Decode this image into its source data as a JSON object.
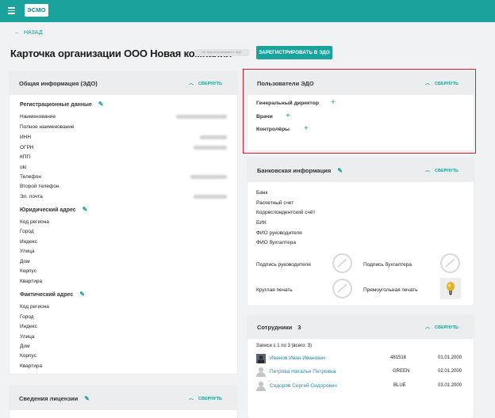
{
  "app": {
    "logo_text": "ЭСМО",
    "brand_color": "#1aa39c"
  },
  "nav": {
    "back_label": "НАЗАД"
  },
  "page": {
    "title": "Карточка организации ООО Новая компания",
    "status_badge": "Не зарегистрирована в ЭДО",
    "register_button": "ЗАРЕГИСТРИРОВАТЬ В ЭДО"
  },
  "general": {
    "title": "Общая информация (ЭДО)",
    "collapse_label": "СВЕРНУТЬ",
    "reg_title": "Регистрационные данные",
    "reg_fields": [
      "Наименование",
      "Полное наименование",
      "ИНН",
      "ОГРН",
      "КПП",
      "oki",
      "Телефон",
      "Второй телефон",
      "Эл. почта"
    ],
    "legal_title": "Юридический адрес",
    "legal_fields": [
      "Код региона",
      "Город",
      "Индекс",
      "Улица",
      "Дом",
      "Корпус",
      "Квартира"
    ],
    "actual_title": "Фактический адрес",
    "actual_fields": [
      "Код региона",
      "Город",
      "Индекс",
      "Улица",
      "Дом",
      "Корпус",
      "Квартира"
    ]
  },
  "license": {
    "title": "Сведения лицензии",
    "collapse_label": "СВЕРНУТЬ"
  },
  "edo_users": {
    "title": "Пользователи ЭДО",
    "collapse_label": "СВЕРНУТЬ",
    "roles": [
      "Генеральный директор",
      "Врачи",
      "Контролёры"
    ],
    "highlight_color": "#d11f2b"
  },
  "bank": {
    "title": "Банковская информация",
    "collapse_label": "СВЕРНУТЬ",
    "fields": [
      "Банк",
      "Расчетный счет",
      "Корреспондентский счёт",
      "БИК",
      "ФИО руководителя",
      "ФИО бухгалтера"
    ],
    "sign_head": "Подпись руководителя",
    "sign_accountant": "Подпись бухгалтера",
    "round_stamp": "Круглая печать",
    "rect_stamp": "Прямоугольная печать"
  },
  "employees": {
    "title": "Сотрудники",
    "count": "3",
    "collapse_label": "СВЕРНУТЬ",
    "summary": "Записи с 1 по 3 (всего: 3)",
    "rows": [
      {
        "name": "Иванов Иван Иванович",
        "code": "481516",
        "date": "01.01.2000",
        "avatar": "photo"
      },
      {
        "name": "Петрова Наталья Петровна",
        "code": "GREEN",
        "date": "02.01.2000",
        "avatar": "placeholder"
      },
      {
        "name": "Сидоров Сергей Сидорович",
        "code": "BLUE",
        "date": "03.01.2000",
        "avatar": "placeholder"
      }
    ]
  }
}
